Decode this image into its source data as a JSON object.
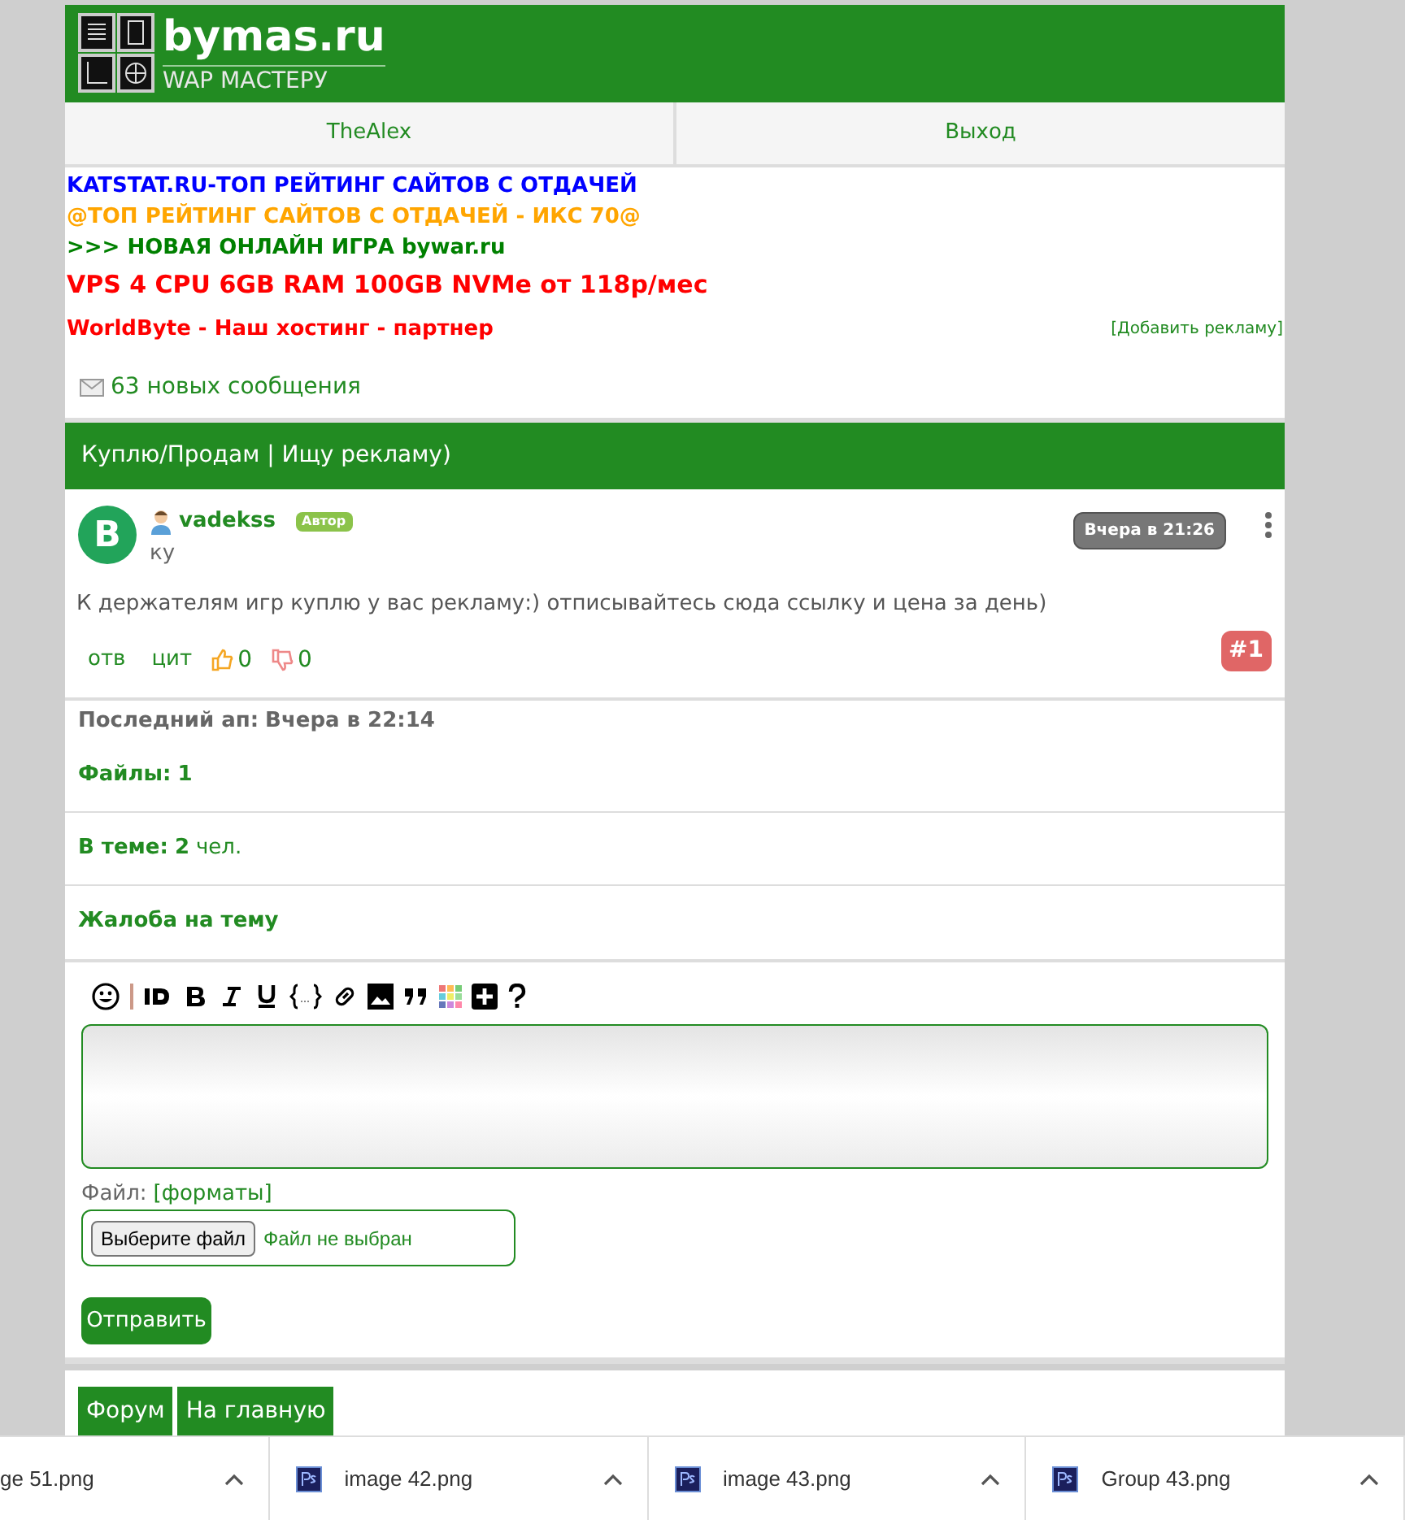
{
  "header": {
    "logo_title": "bymas.ru",
    "logo_subtitle": "WAP МАСТЕРУ"
  },
  "nav": [
    {
      "label": "TheAlex"
    },
    {
      "label": "Выход"
    }
  ],
  "ads": [
    {
      "text": "KATSTAT.RU-ТОП РЕЙТИНГ САЙТОВ С ОТДАЧЕЙ",
      "color": "#0000ff"
    },
    {
      "text": "@ТОП РЕЙТИНГ САЙТОВ С ОТДАЧЕЙ - ИКС 70@",
      "color": "#ffa500"
    },
    {
      "text": ">>> НОВАЯ ОНЛАЙН ИГРА bywar.ru",
      "color": "#008000"
    },
    {
      "text": "VPS 4 CPU 6GB RAM 100GB NVMe от 118р/мес",
      "color": "#ff0000"
    },
    {
      "text": "WorldByte - Наш хостинг - партнер",
      "color": "#ff0000"
    }
  ],
  "add_ad_link": "[Добавить рекламу]",
  "messages_link": "63 новых сообщения",
  "topic_title": "Куплю/Продам | Ищу рекламу)",
  "post": {
    "avatar_letter": "B",
    "author": "vadekss",
    "badge": "Автор",
    "status": "ку",
    "time": "Вчера в 21:26",
    "text": "К держателям игр куплю у вас рекламу:) отписывайтесь сюда ссылку и цена за день)",
    "reply": "отв",
    "quote": "цит",
    "likes": "0",
    "dislikes": "0",
    "number": "#1"
  },
  "info": {
    "last_up_label": "Последний ап:",
    "last_up_value": "Вчера в 22:14",
    "files_label": "Файлы:",
    "files_value": "1",
    "in_topic_label": "В теме:",
    "in_topic_count": "2",
    "in_topic_unit": "чел.",
    "complaint": "Жалоба на тему"
  },
  "editor": {
    "file_label": "Файл:",
    "formats_link": "[форматы]",
    "choose_button": "Выберите файл",
    "no_file": "Файл не выбран",
    "submit": "Отправить"
  },
  "footer_buttons": [
    {
      "label": "Форум"
    },
    {
      "label": "На главную"
    }
  ],
  "downloads": [
    {
      "name": "ge 51.png",
      "kind": "plain"
    },
    {
      "name": "image 42.png",
      "kind": "ps"
    },
    {
      "name": "image 43.png",
      "kind": "ps"
    },
    {
      "name": "Group 43.png",
      "kind": "ps"
    }
  ]
}
